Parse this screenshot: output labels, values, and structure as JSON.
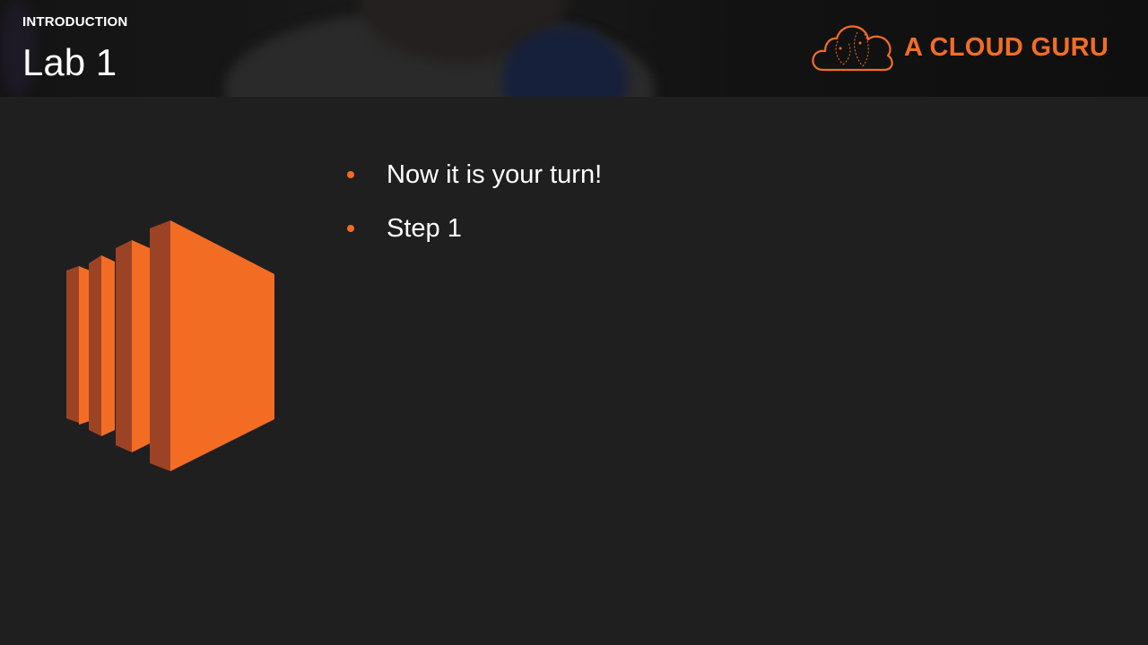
{
  "header": {
    "section": "INTRODUCTION",
    "title": "Lab 1"
  },
  "logo": {
    "text": "A CLOUD GURU",
    "icon": "cloud-logo-icon",
    "color": "#f26d23"
  },
  "illustration": {
    "icon": "ec2-instance-icon",
    "colors": {
      "front": "#f26d23",
      "side": "#9d4325"
    }
  },
  "bullets": [
    {
      "text": "Now it is your turn!"
    },
    {
      "text": "Step 1"
    }
  ],
  "colors": {
    "background": "#1f1f1f",
    "accent": "#f26d23",
    "text": "#ffffff"
  }
}
